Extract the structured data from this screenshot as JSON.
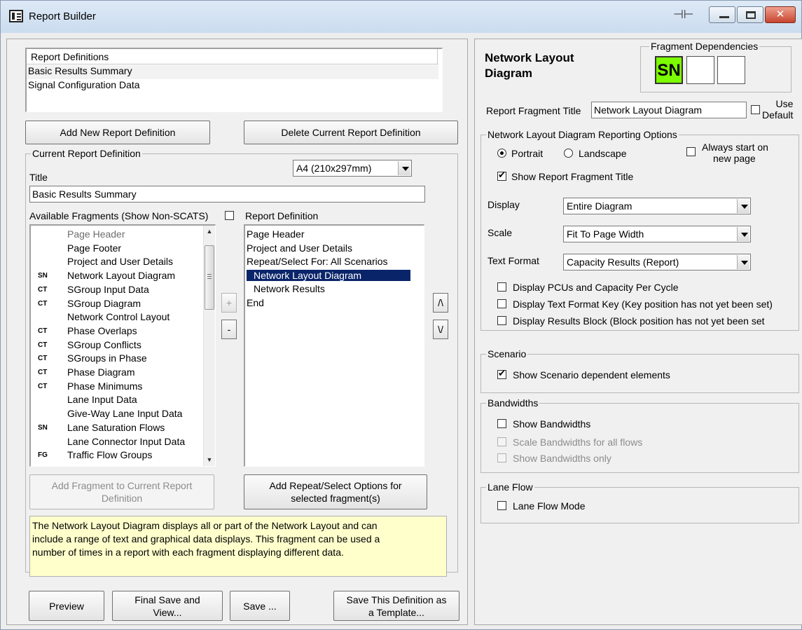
{
  "window": {
    "title": "Report Builder"
  },
  "left": {
    "report_definitions": {
      "header": "Report Definitions",
      "items": [
        "Basic Results Summary",
        "Signal Configuration Data"
      ]
    },
    "add_definition_label": "Add New Report Definition",
    "delete_definition_label": "Delete Current Report Definition",
    "current_definition": {
      "legend": "Current Report Definition",
      "title_label": "Title",
      "title_value": "Basic Results Summary",
      "page_size": "A4 (210x297mm)",
      "available_label": "Available Fragments (Show Non-SCATS)",
      "report_definition_label": "Report Definition"
    },
    "fragments": [
      {
        "code": "",
        "label": "Page Header"
      },
      {
        "code": "",
        "label": "Page Footer"
      },
      {
        "code": "",
        "label": "Project and User Details"
      },
      {
        "code": "SN",
        "label": "Network Layout Diagram"
      },
      {
        "code": "CT",
        "label": "SGroup Input Data"
      },
      {
        "code": "CT",
        "label": "SGroup Diagram"
      },
      {
        "code": "",
        "label": "Network Control Layout"
      },
      {
        "code": "CT",
        "label": "Phase Overlaps"
      },
      {
        "code": "CT",
        "label": "SGroup Conflicts"
      },
      {
        "code": "CT",
        "label": "SGroups in Phase"
      },
      {
        "code": "CT",
        "label": "Phase Diagram"
      },
      {
        "code": "CT",
        "label": "Phase Minimums"
      },
      {
        "code": "",
        "label": "Lane Input Data"
      },
      {
        "code": "",
        "label": "Give-Way Lane Input Data"
      },
      {
        "code": "SN",
        "label": "Lane Saturation Flows"
      },
      {
        "code": "",
        "label": "Lane Connector Input Data"
      },
      {
        "code": "FG",
        "label": "Traffic Flow Groups"
      }
    ],
    "definition_items": [
      "Page Header",
      "Project and User Details",
      "Repeat/Select For: All Scenarios",
      "Network Layout Diagram",
      "Network Results",
      "End"
    ],
    "plus_label": "+",
    "minus_label": "-",
    "up_label": "/\\",
    "down_label": "\\/",
    "add_fragment_label_1": "Add Fragment to Current Report",
    "add_fragment_label_2": "Definition",
    "add_repeat_label_1": "Add Repeat/Select Options for",
    "add_repeat_label_2": "selected fragment(s)",
    "description_line_1": "The Network Layout Diagram displays all or part of the Network Layout and can",
    "description_line_2": "include a range of text and graphical data displays. This fragment can be used a",
    "description_line_3": "number of times in a report with each fragment displaying different data.",
    "preview_label": "Preview",
    "final_save_label_1": "Final Save and",
    "final_save_label_2": "View...",
    "save_label": "Save ...",
    "save_template_label_1": "Save This Definition as",
    "save_template_label_2": "a Template..."
  },
  "right": {
    "heading_line_1": "Network Layout",
    "heading_line_2": "Diagram",
    "dependencies_legend": "Fragment Dependencies",
    "dependency_code": "SN",
    "fragment_title_label": "Report Fragment Title",
    "fragment_title_value": "Network Layout Diagram",
    "use_default_label_1": "Use",
    "use_default_label_2": "Default",
    "options_legend": "Network Layout Diagram Reporting Options",
    "portrait_label": "Portrait",
    "landscape_label": "Landscape",
    "always_new_page_label_1": "Always start on",
    "always_new_page_label_2": "new page",
    "show_title_label": "Show Report Fragment Title",
    "display_label": "Display",
    "display_value": "Entire Diagram",
    "scale_label": "Scale",
    "scale_value": "Fit To Page Width",
    "text_format_label": "Text Format",
    "text_format_value": "Capacity Results (Report)",
    "display_pcus_label": "Display PCUs and Capacity Per Cycle",
    "display_key_label": "Display Text Format Key (Key position has not yet been set)",
    "display_results_label": "Display Results Block (Block position has not yet been set",
    "scenario_legend": "Scenario",
    "show_scenario_label": "Show Scenario dependent elements",
    "bandwidths_legend": "Bandwidths",
    "show_bandwidths_label": "Show Bandwidths",
    "scale_bandwidths_label": "Scale Bandwidths for all flows",
    "bandwidths_only_label": "Show Bandwidths only",
    "lane_flow_legend": "Lane Flow",
    "lane_flow_mode_label": "Lane Flow Mode"
  }
}
